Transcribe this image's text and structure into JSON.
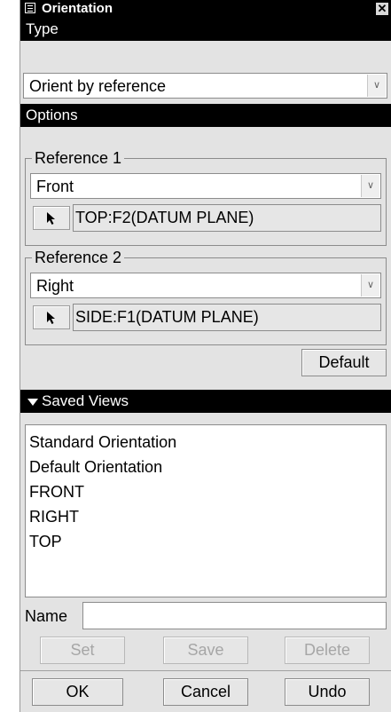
{
  "window": {
    "title": "Orientation",
    "close_glyph": "✕"
  },
  "type_section": {
    "label": "Type",
    "combo_value": "Orient by reference"
  },
  "options_section": {
    "label": "Options",
    "reference1": {
      "label": "Reference 1",
      "direction": "Front",
      "reference_value": "TOP:F2(DATUM PLANE)"
    },
    "reference2": {
      "label": "Reference 2",
      "direction": "Right",
      "reference_value": "SIDE:F1(DATUM PLANE)"
    },
    "default_button": "Default"
  },
  "saved_views": {
    "label": "Saved Views",
    "items": [
      "Standard Orientation",
      "Default Orientation",
      "FRONT",
      "RIGHT",
      "TOP"
    ],
    "name_label": "Name",
    "name_value": "",
    "set_button": "Set",
    "save_button": "Save",
    "delete_button": "Delete"
  },
  "footer": {
    "ok": "OK",
    "cancel": "Cancel",
    "undo": "Undo"
  },
  "icons": {
    "window": "window-icon",
    "close": "close-icon",
    "dropdown": "chevron-down-icon",
    "select": "arrow-pointer-icon",
    "collapse": "triangle-down-icon"
  },
  "colors": {
    "section_bar": "#000000",
    "panel": "#e3e3e3",
    "disabled_text": "#a6a6a6"
  }
}
